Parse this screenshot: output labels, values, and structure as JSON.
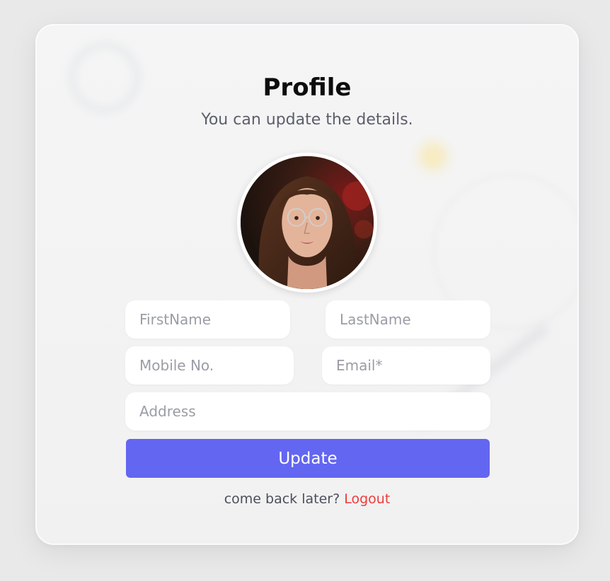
{
  "profile": {
    "title": "Profile",
    "subtitle": "You can update the details."
  },
  "form": {
    "first_name_placeholder": "FirstName",
    "last_name_placeholder": "LastName",
    "mobile_placeholder": "Mobile No.",
    "email_placeholder": "Email*",
    "address_placeholder": "Address",
    "update_label": "Update"
  },
  "footer": {
    "prompt": "come back later?",
    "logout_label": "Logout"
  },
  "colors": {
    "accent": "#6366f1",
    "logout": "#ef3b3b",
    "background": "#e9e9ea"
  }
}
